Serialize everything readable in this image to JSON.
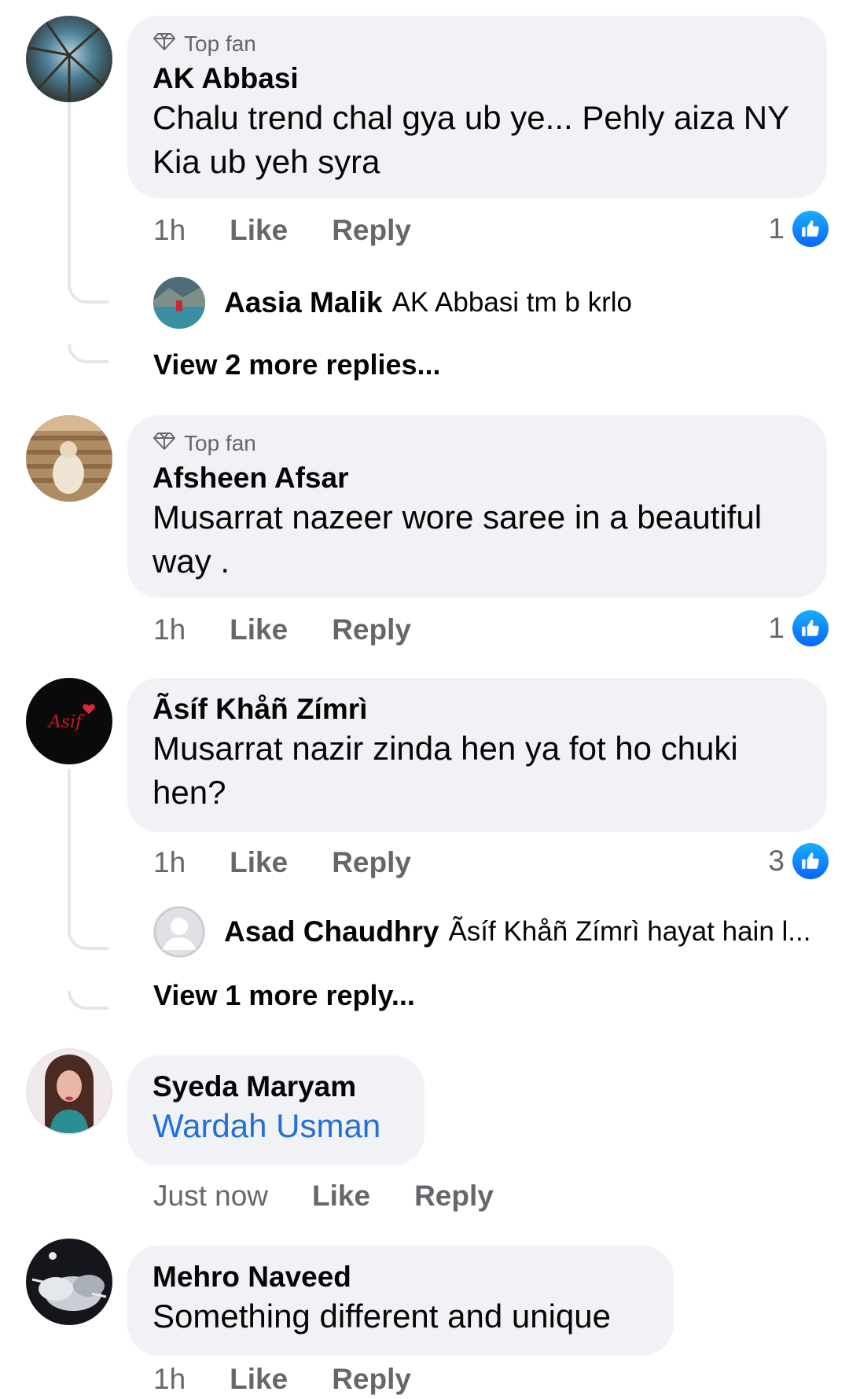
{
  "comments": [
    {
      "badge": "Top fan",
      "author": "AK Abbasi",
      "text": "Chalu trend chal gya ub ye... Pehly aiza NY Kia ub yeh syra",
      "time": "1h",
      "like_label": "Like",
      "reply_label": "Reply",
      "reaction_count": "1",
      "reply_preview": {
        "author": "Aasia Malik",
        "text": "AK Abbasi tm b krlo"
      },
      "view_more": "View 2 more replies..."
    },
    {
      "badge": "Top fan",
      "author": "Afsheen Afsar",
      "text": "Musarrat nazeer wore saree in a beautiful way .",
      "time": "1h",
      "like_label": "Like",
      "reply_label": "Reply",
      "reaction_count": "1"
    },
    {
      "author": "Ãsíf Khåñ Zímrì",
      "text": "Musarrat nazir zinda hen ya fot ho chuki hen?",
      "time": "1h",
      "like_label": "Like",
      "reply_label": "Reply",
      "reaction_count": "3",
      "reply_preview": {
        "author": "Asad Chaudhry",
        "text": "Ãsíf Khåñ Zímrì hayat hain l..."
      },
      "view_more": "View 1 more reply...",
      "avatar_text": "Asif"
    },
    {
      "author": "Syeda Maryam",
      "mention": "Wardah Usman",
      "time": "Just now",
      "like_label": "Like",
      "reply_label": "Reply"
    },
    {
      "author": "Mehro Naveed",
      "text": "Something different and unique",
      "time": "1h",
      "like_label": "Like",
      "reply_label": "Reply"
    }
  ],
  "colors": {
    "bubble": "#f0f2f5",
    "secondary_text": "#65676b",
    "mention": "#216fdb",
    "like_blue": "#0866ff"
  }
}
